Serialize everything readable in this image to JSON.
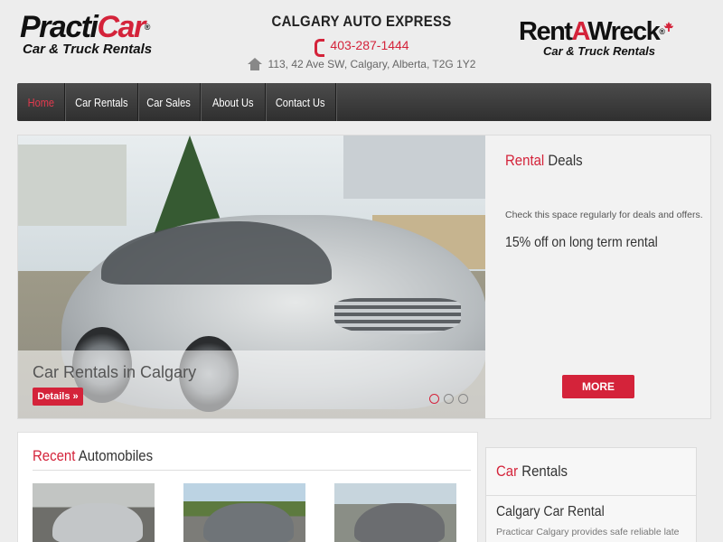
{
  "header": {
    "logo_left": {
      "brand_main": "Practi",
      "brand_accent": "Car",
      "reg": "®",
      "tagline": "Car & Truck Rentals"
    },
    "company": "CALGARY AUTO EXPRESS",
    "phone": "403-287-1444",
    "address": "113, 42 Ave SW, Calgary, Alberta, T2G 1Y2",
    "logo_right": {
      "brand_a": "Rent",
      "brand_b": "A",
      "brand_c": "Wreck",
      "reg": "®",
      "tagline": "Car & Truck Rentals"
    }
  },
  "nav": {
    "items": [
      {
        "label": "Home",
        "active": true
      },
      {
        "label": "Car Rentals",
        "active": false
      },
      {
        "label": "Car Sales",
        "active": false
      },
      {
        "label": "About Us",
        "active": false
      },
      {
        "label": "Contact Us",
        "active": false
      }
    ]
  },
  "slider": {
    "caption": "Car Rentals in Calgary",
    "details_label": "Details »",
    "slide_count": 3,
    "active_slide": 1
  },
  "deals": {
    "title_accent": "Rental",
    "title_rest": " Deals",
    "note": "Check this space regularly for deals and offers.",
    "offer": "15% off on long term rental",
    "more_label": "MORE"
  },
  "recent": {
    "title_accent": "Recent",
    "title_rest": " Automobiles"
  },
  "sidebar": {
    "title_accent": "Car",
    "title_rest": " Rentals",
    "subtitle": "Calgary Car Rental",
    "text": "Practicar Calgary provides safe reliable late"
  },
  "colors": {
    "accent": "#d4233a",
    "nav_bg": "#3a3a3a",
    "page_bg": "#ededed"
  },
  "icons": {
    "phone": "phone-icon",
    "address": "home-icon"
  }
}
